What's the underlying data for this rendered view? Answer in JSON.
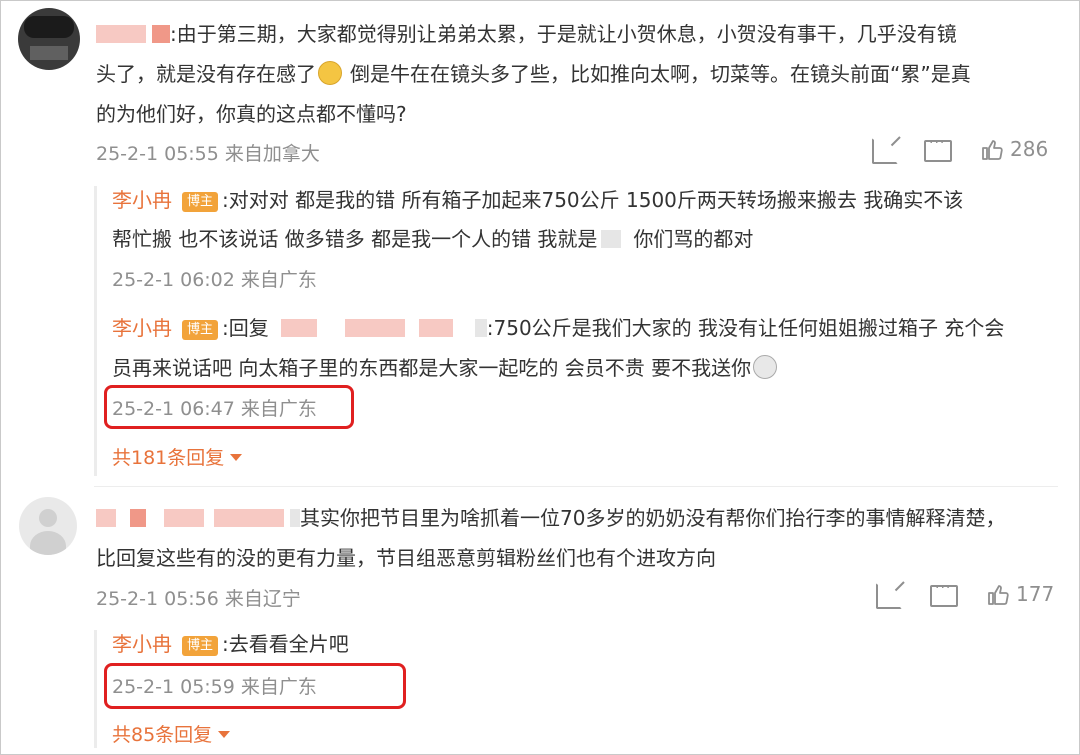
{
  "comments": [
    {
      "line1": ":由于第三期，大家都觉得别让弟弟太累，于是就让小贺休息，小贺没有事干，几乎没有镜",
      "line2": "头了，就是没有存在感了",
      "line2b": "倒是牛在在镜头多了些，比如推向太啊，切菜等。在镜头前面“累”是真",
      "line3": "的为他们好，你真的这点都不懂吗?",
      "meta": "25-2-1 05:55 来自加拿大",
      "likes": "286",
      "replies": [
        {
          "name": "李小冉",
          "badge": "博主",
          "line1": ":对对对 都是我的错 所有箱子加起来750公斤 1500斤两天转场搬来搬去 我确实不该",
          "line2a": "帮忙搬 也不该说话 做多错多 都是我一个人的错 我就是",
          "line2b": "你们骂的都对",
          "meta": "25-2-1 06:02 来自广东"
        },
        {
          "name": "李小冉",
          "badge": "博主",
          "line1a": ":回复",
          "line1b": ":750公斤是我们大家的 我没有让任何姐姐搬过箱子 充个会",
          "line2": "员再来说话吧 向太箱子里的东西都是大家一起吃的 会员不贵 要不我送你",
          "meta": "25-2-1 06:47 来自广东"
        }
      ],
      "more": "共181条回复"
    },
    {
      "line1": "其实你把节目里为啥抓着一位70多岁的奶奶没有帮你们抬行李的事情解释清楚，",
      "line2": "比回复这些有的没的更有力量，节目组恶意剪辑粉丝们也有个进攻方向",
      "meta": "25-2-1 05:56 来自辽宁",
      "likes": "177",
      "replies": [
        {
          "name": "李小冉",
          "badge": "博主",
          "line1": ":去看看全片吧",
          "meta": "25-2-1 05:59 来自广东"
        }
      ],
      "more": "共85条回复"
    }
  ]
}
